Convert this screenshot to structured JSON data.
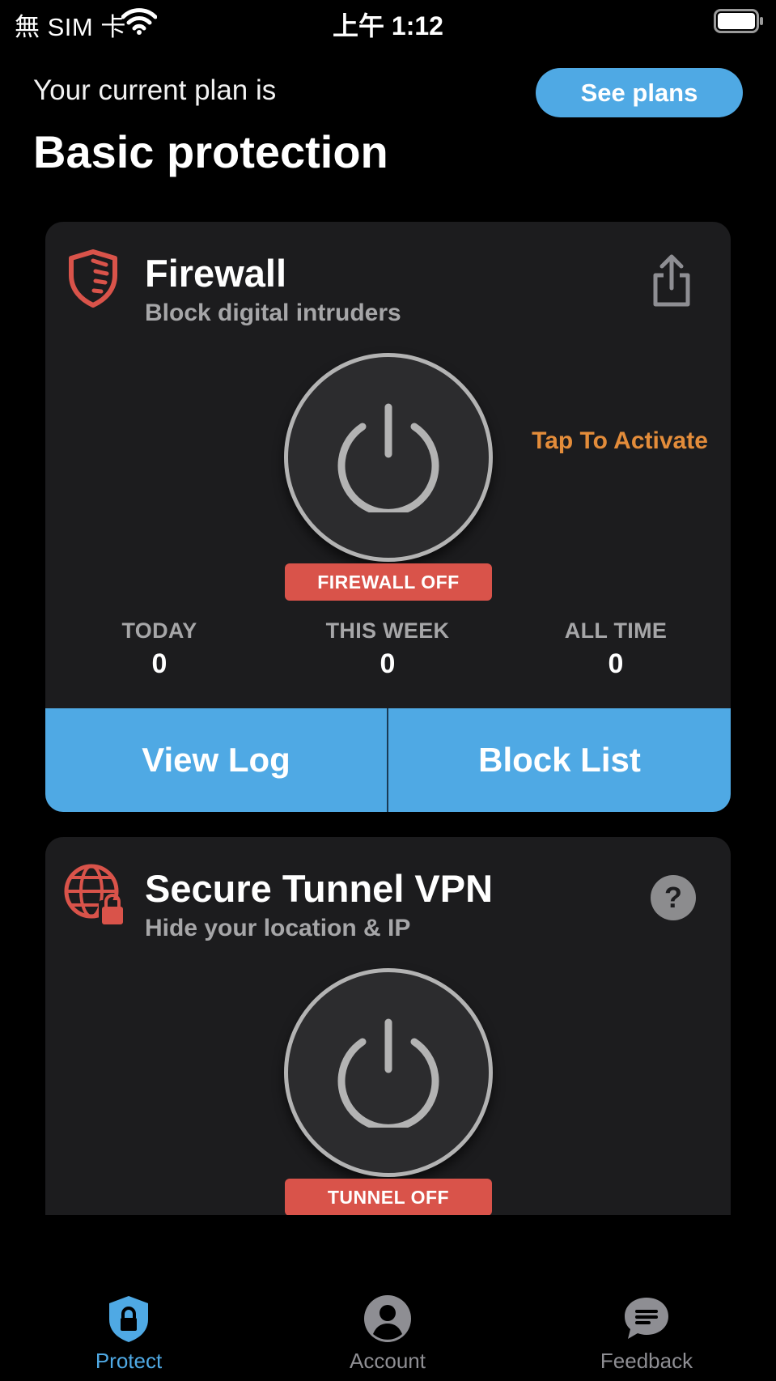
{
  "status_bar": {
    "carrier": "無 SIM 卡",
    "time": "上午 1:12"
  },
  "plan": {
    "label": "Your current plan is",
    "name": "Basic protection",
    "see_plans": "See plans"
  },
  "firewall": {
    "icon": "shield-icon",
    "title": "Firewall",
    "subtitle": "Block digital intruders",
    "hint": "Tap To Activate",
    "status": "FIREWALL OFF",
    "stats": [
      {
        "label": "TODAY",
        "value": "0"
      },
      {
        "label": "THIS WEEK",
        "value": "0"
      },
      {
        "label": "ALL TIME",
        "value": "0"
      }
    ],
    "view_log": "View Log",
    "block_list": "Block List"
  },
  "vpn": {
    "icon": "globe-lock-icon",
    "title": "Secure Tunnel VPN",
    "subtitle": "Hide your location & IP",
    "help": "?",
    "status": "TUNNEL OFF"
  },
  "tabs": [
    {
      "label": "Protect",
      "icon": "lock-shield-icon",
      "active": true
    },
    {
      "label": "Account",
      "icon": "person-icon",
      "active": false
    },
    {
      "label": "Feedback",
      "icon": "chat-bubble-icon",
      "active": false
    }
  ],
  "colors": {
    "accent": "#4fa9e4",
    "danger": "#d9534a",
    "hint": "#e38c3a",
    "card": "#1c1c1e"
  }
}
